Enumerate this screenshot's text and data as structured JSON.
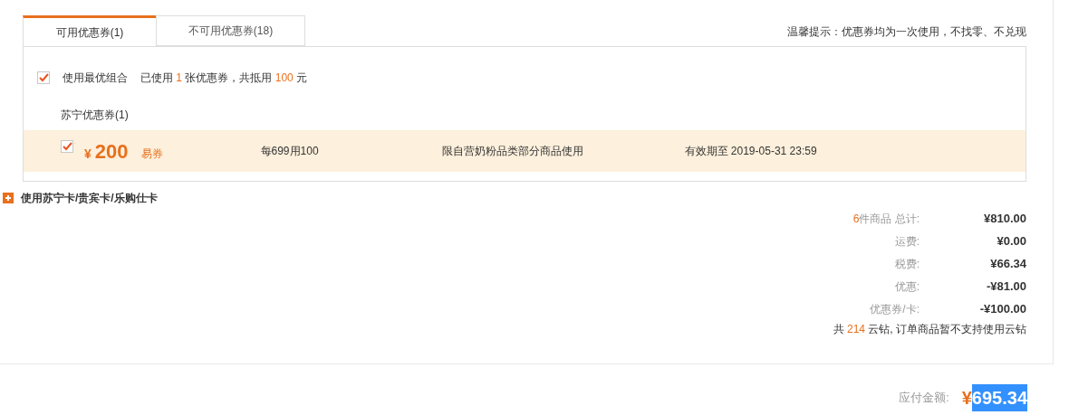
{
  "tabs": [
    {
      "label": "可用优惠券(1)",
      "selected": true
    },
    {
      "label": "不可用优惠券(18)",
      "selected": false
    }
  ],
  "notice": "温馨提示：优惠券均为一次使用，不找零、不兑现",
  "best_combo": {
    "checked": true,
    "label": "使用最优组合",
    "summary": {
      "prefix": "已使用",
      "count": "1",
      "middle": "张优惠券，共抵用",
      "amount": "100",
      "suffix": "元"
    }
  },
  "coupon_group": {
    "title": "苏宁优惠券(1)",
    "coupons": [
      {
        "checked": true,
        "currency": "¥",
        "amount": "200",
        "type": "易券",
        "rule": "每699用100",
        "scope": "限自营奶粉品类部分商品使用",
        "validity": "有效期至 2019-05-31 23:59"
      }
    ]
  },
  "cards_section": {
    "label": "使用苏宁卡/贵宾卡/乐购仕卡",
    "expanded": false
  },
  "summary": [
    {
      "count": "6",
      "label": "件商品 总计:",
      "value": "¥810.00"
    },
    {
      "label": "运费:",
      "value": "¥0.00"
    },
    {
      "label": "税费:",
      "value": "¥66.34"
    },
    {
      "label": "优惠:",
      "value": "-¥81.00"
    },
    {
      "label": "优惠券/卡:",
      "value": "-¥100.00"
    }
  ],
  "cloud_diamonds": {
    "prefix": "共",
    "count": "214",
    "suffix": "云钻, 订单商品暂不支持使用云钻"
  },
  "total": {
    "label": "应付金额:",
    "currency": "¥",
    "amount": "695.34",
    "selected": true
  }
}
